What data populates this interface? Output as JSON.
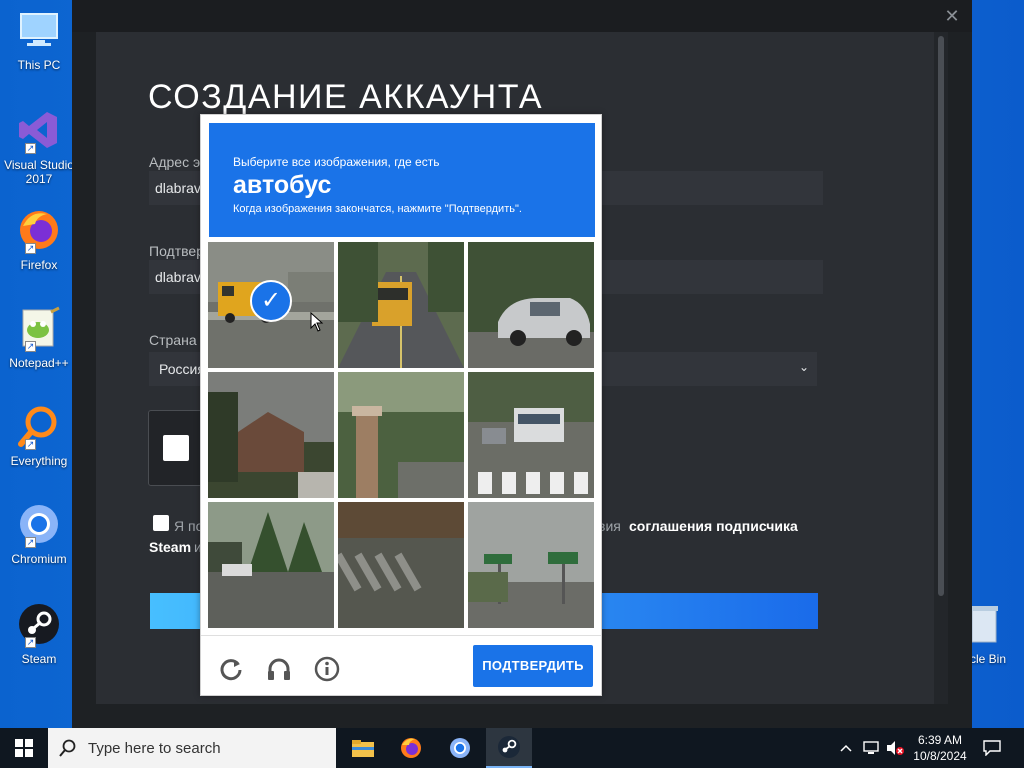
{
  "desktop": {
    "icons": [
      {
        "label": "This PC",
        "icon": "computer-icon"
      },
      {
        "label": "Visual Studio 2017",
        "icon": "visual-studio-icon"
      },
      {
        "label": "Firefox",
        "icon": "firefox-icon"
      },
      {
        "label": "Notepad++",
        "icon": "notepad-plus-plus-icon"
      },
      {
        "label": "Everything",
        "icon": "everything-search-icon"
      },
      {
        "label": "Chromium",
        "icon": "chromium-icon"
      },
      {
        "label": "Steam",
        "icon": "steam-icon"
      }
    ],
    "recycle_bin_label": "cle Bin"
  },
  "steam_window": {
    "close_glyph": "✕",
    "heading": "СОЗДАНИЕ АККАУНТА",
    "email_label": "Адрес э",
    "email_value": "dlabrav",
    "confirm_label": "Подтверд",
    "confirm_value": "dlabrav",
    "country_label": "Страна",
    "country_value": "Россия",
    "agree_text_start": "Я по",
    "agree_text_mid": "вия",
    "agree_link_1": "соглашения подписчика",
    "agree_link_2_start": "Steam",
    "agree_text_end": "и"
  },
  "captcha": {
    "instruction": "Выберите все изображения, где есть",
    "keyword": "автобус",
    "hint": "Когда изображения закончатся, нажмите \"Подтвердить\".",
    "tiles": [
      {
        "id": 1,
        "scene": "school bus on street",
        "selected": true
      },
      {
        "id": 2,
        "scene": "school bus on road",
        "selected": false
      },
      {
        "id": 3,
        "scene": "silver car parked",
        "selected": false
      },
      {
        "id": 4,
        "scene": "house and trees",
        "selected": false
      },
      {
        "id": 5,
        "scene": "stone pillar and trees",
        "selected": false
      },
      {
        "id": 6,
        "scene": "transit bus at crosswalk",
        "selected": false
      },
      {
        "id": 7,
        "scene": "street with trees and car",
        "selected": false
      },
      {
        "id": 8,
        "scene": "crosswalk",
        "selected": false
      },
      {
        "id": 9,
        "scene": "traffic signs",
        "selected": false
      }
    ],
    "selected_mark": "✓",
    "tools": [
      "reload-icon",
      "headphones-icon",
      "info-icon"
    ],
    "verify_label": "ПОДТВЕРДИТЬ",
    "accent": "#1a73e8"
  },
  "taskbar": {
    "search_placeholder": "Type here to search",
    "apps": [
      "file-explorer-icon",
      "firefox-icon",
      "chromium-icon",
      "steam-icon"
    ],
    "active_app": "steam-icon",
    "time": "6:39 AM",
    "date": "10/8/2024"
  }
}
